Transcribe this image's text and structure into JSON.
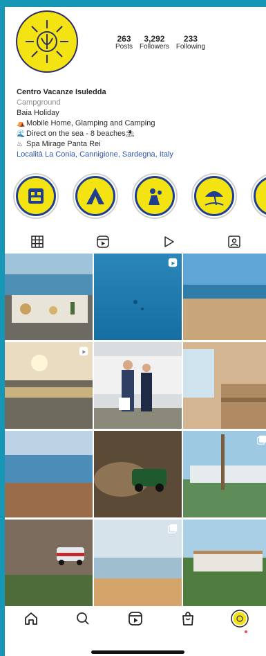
{
  "profile": {
    "stats": [
      {
        "num": "263",
        "label": "Posts"
      },
      {
        "num": "3,292",
        "label": "Followers"
      },
      {
        "num": "233",
        "label": "Following"
      }
    ],
    "name": "Centro Vacanze Isuledda",
    "category": "Campground",
    "bio_lines": [
      "Baia Holiday",
      "Mobile Home, Glamping and Camping",
      "Direct on the sea - 8 beaches",
      "Spa Mirage Panta Rei"
    ],
    "location_link": "Località La Conia, Cannigione, Sardegna, Italy"
  },
  "highlights": [
    {
      "icon": "building-icon"
    },
    {
      "icon": "tent-icon"
    },
    {
      "icon": "kids-icon"
    },
    {
      "icon": "beach-umbrella-icon"
    },
    {
      "icon": "family-icon"
    }
  ],
  "tabs": [
    {
      "icon": "grid-icon",
      "active": true
    },
    {
      "icon": "reels-icon",
      "active": false
    },
    {
      "icon": "play-icon",
      "active": false
    },
    {
      "icon": "tagged-icon",
      "active": false
    }
  ],
  "grid_posts": [
    {
      "scene": "seaside-dinner-table",
      "badge": ""
    },
    {
      "scene": "underwater-blue",
      "badge": "reels-badge-icon"
    },
    {
      "scene": "sandy-beach",
      "badge": ""
    },
    {
      "scene": "sunset-sea",
      "badge": "reels-badge-icon"
    },
    {
      "scene": "couple-with-motorhome",
      "badge": ""
    },
    {
      "scene": "wooden-sauna",
      "badge": ""
    },
    {
      "scene": "rocky-coast",
      "badge": ""
    },
    {
      "scene": "rally-car-dust",
      "badge": ""
    },
    {
      "scene": "pool-with-palms",
      "badge": "multi-badge-icon"
    },
    {
      "scene": "rally-car-rocks",
      "badge": ""
    },
    {
      "scene": "calm-sea-boats",
      "badge": "multi-badge-icon"
    },
    {
      "scene": "mobile-homes-garden",
      "badge": ""
    }
  ],
  "bottom_nav": [
    {
      "icon": "home-icon"
    },
    {
      "icon": "search-icon"
    },
    {
      "icon": "reels-icon"
    },
    {
      "icon": "shop-icon"
    },
    {
      "icon": "profile-avatar-icon"
    }
  ],
  "colors": {
    "background": "#1597b5",
    "logo_yellow": "#f4e313",
    "logo_navy": "#1e3f8f",
    "link_blue": "#2d56a8"
  }
}
